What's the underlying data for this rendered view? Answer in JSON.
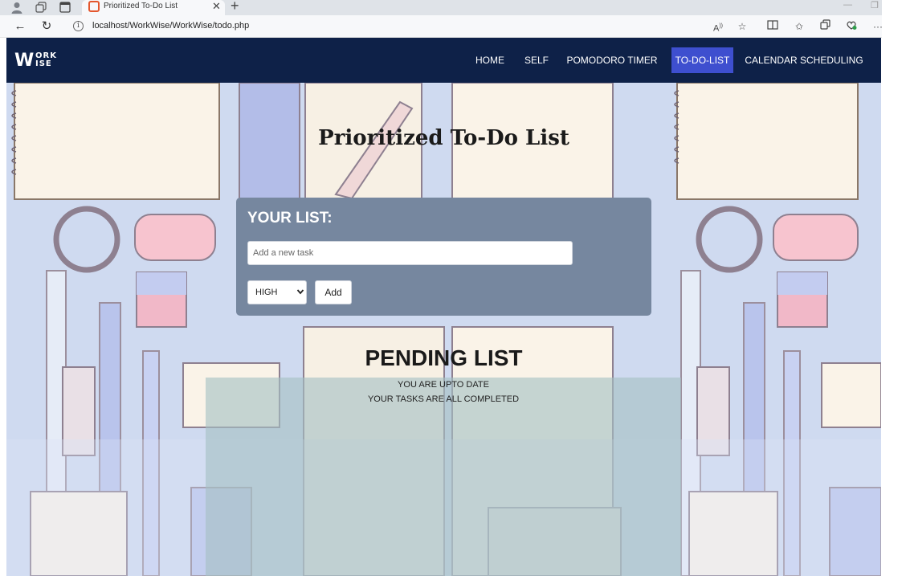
{
  "browser": {
    "tab_title": "Prioritized To-Do List",
    "url": "localhost/WorkWise/WorkWise/todo.php",
    "icons": {
      "profile": "profile-icon",
      "collections": "collections-icon",
      "tab_actions": "tab-actions-icon",
      "favicon": "favicon-icon",
      "close": "close-icon",
      "new_tab": "plus-icon",
      "back": "back-arrow-icon",
      "refresh": "refresh-icon",
      "info": "info-icon",
      "read_aloud": "read-aloud-icon",
      "favorite": "star-icon",
      "split": "split-screen-icon",
      "favorites": "favorites-icon",
      "collections_bar": "collections-icon",
      "extensions": "extensions-icon",
      "menu": "more-icon"
    }
  },
  "navbar": {
    "logo": {
      "w": "W",
      "ork": "ORK",
      "ise": "ISE"
    },
    "items": [
      {
        "label": "HOME",
        "active": false
      },
      {
        "label": "SELF",
        "active": false
      },
      {
        "label": "POMODORO TIMER",
        "active": false
      },
      {
        "label": "TO-DO-LIST",
        "active": true
      },
      {
        "label": "CALENDAR SCHEDULING",
        "active": false
      }
    ]
  },
  "page": {
    "title": "Prioritized To-Do List"
  },
  "list_card": {
    "heading": "YOUR LIST:",
    "input_placeholder": "Add a new task",
    "input_value": "",
    "priority_selected": "HIGH",
    "add_label": "Add"
  },
  "pending": {
    "title": "PENDING LIST",
    "line1": "YOU ARE UPTO DATE",
    "line2": "YOUR TASKS ARE ALL COMPLETED"
  },
  "colors": {
    "navbar_bg": "#0e2148",
    "nav_active_bg": "#3e4fcf",
    "card_bg": "#76879f",
    "page_bg": "#cdd9ef",
    "pending_panel": "#a5c0c4"
  }
}
